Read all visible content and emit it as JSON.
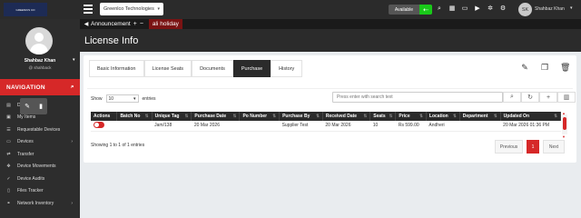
{
  "topbar": {
    "logo_text": "GREENICS CO",
    "org_select": "Greenlco Technologies",
    "availability": "Available",
    "user_initials": "SK",
    "user_name": "Shahbaz Khan"
  },
  "announcement": {
    "label": "Announcement",
    "text": "ali holiday"
  },
  "page_title": "License Info",
  "sidebar": {
    "name": "Shahbaz Khan",
    "handle": "@ shahback",
    "nav_title": "NAVIGATION",
    "items": [
      {
        "label": "Dashboard",
        "icon": "chart-icon",
        "chevron": false
      },
      {
        "label": "My Items",
        "icon": "box-icon",
        "chevron": false
      },
      {
        "label": "Requestable Devices",
        "icon": "list-icon",
        "chevron": false
      },
      {
        "label": "Devices",
        "icon": "monitor-icon",
        "chevron": true
      },
      {
        "label": "Transfer",
        "icon": "transfer-icon",
        "chevron": false
      },
      {
        "label": "Device Movements",
        "icon": "move-icon",
        "chevron": false
      },
      {
        "label": "Device Audits",
        "icon": "audit-icon",
        "chevron": false
      },
      {
        "label": "Files Tracker",
        "icon": "file-icon",
        "chevron": false
      },
      {
        "label": "Network Inventory",
        "icon": "network-icon",
        "chevron": true
      }
    ]
  },
  "tabs": [
    {
      "label": "Basic Information",
      "active": false
    },
    {
      "label": "License Seats",
      "active": false
    },
    {
      "label": "Documents",
      "active": false
    },
    {
      "label": "Purchase",
      "active": true
    },
    {
      "label": "History",
      "active": false
    }
  ],
  "table_controls": {
    "show_label": "Show",
    "page_size": "10",
    "entries_label": "entries",
    "search_placeholder": "Press enter with search text"
  },
  "columns": [
    "Actions",
    "Batch No",
    "Unique Tag",
    "Purchase Date",
    "Po Number",
    "Purchase By",
    "Received Date",
    "Seats",
    "Price",
    "Location",
    "Department",
    "Updated On"
  ],
  "rows": [
    {
      "unique_tag": "Jam/138",
      "purchase_date": "20 Mar 2026",
      "po_number": "",
      "purchase_by": "Supplier Test",
      "received_date": "20 Mar 2026",
      "seats": "10",
      "price": "Rs 599.00",
      "location": "Andheri",
      "department": "",
      "updated_on": "20 Mar 2026 01:36 PM"
    }
  ],
  "footer": {
    "info": "Showing 1 to 1 of 1 entries",
    "prev": "Previous",
    "page": "1",
    "next": "Next"
  }
}
